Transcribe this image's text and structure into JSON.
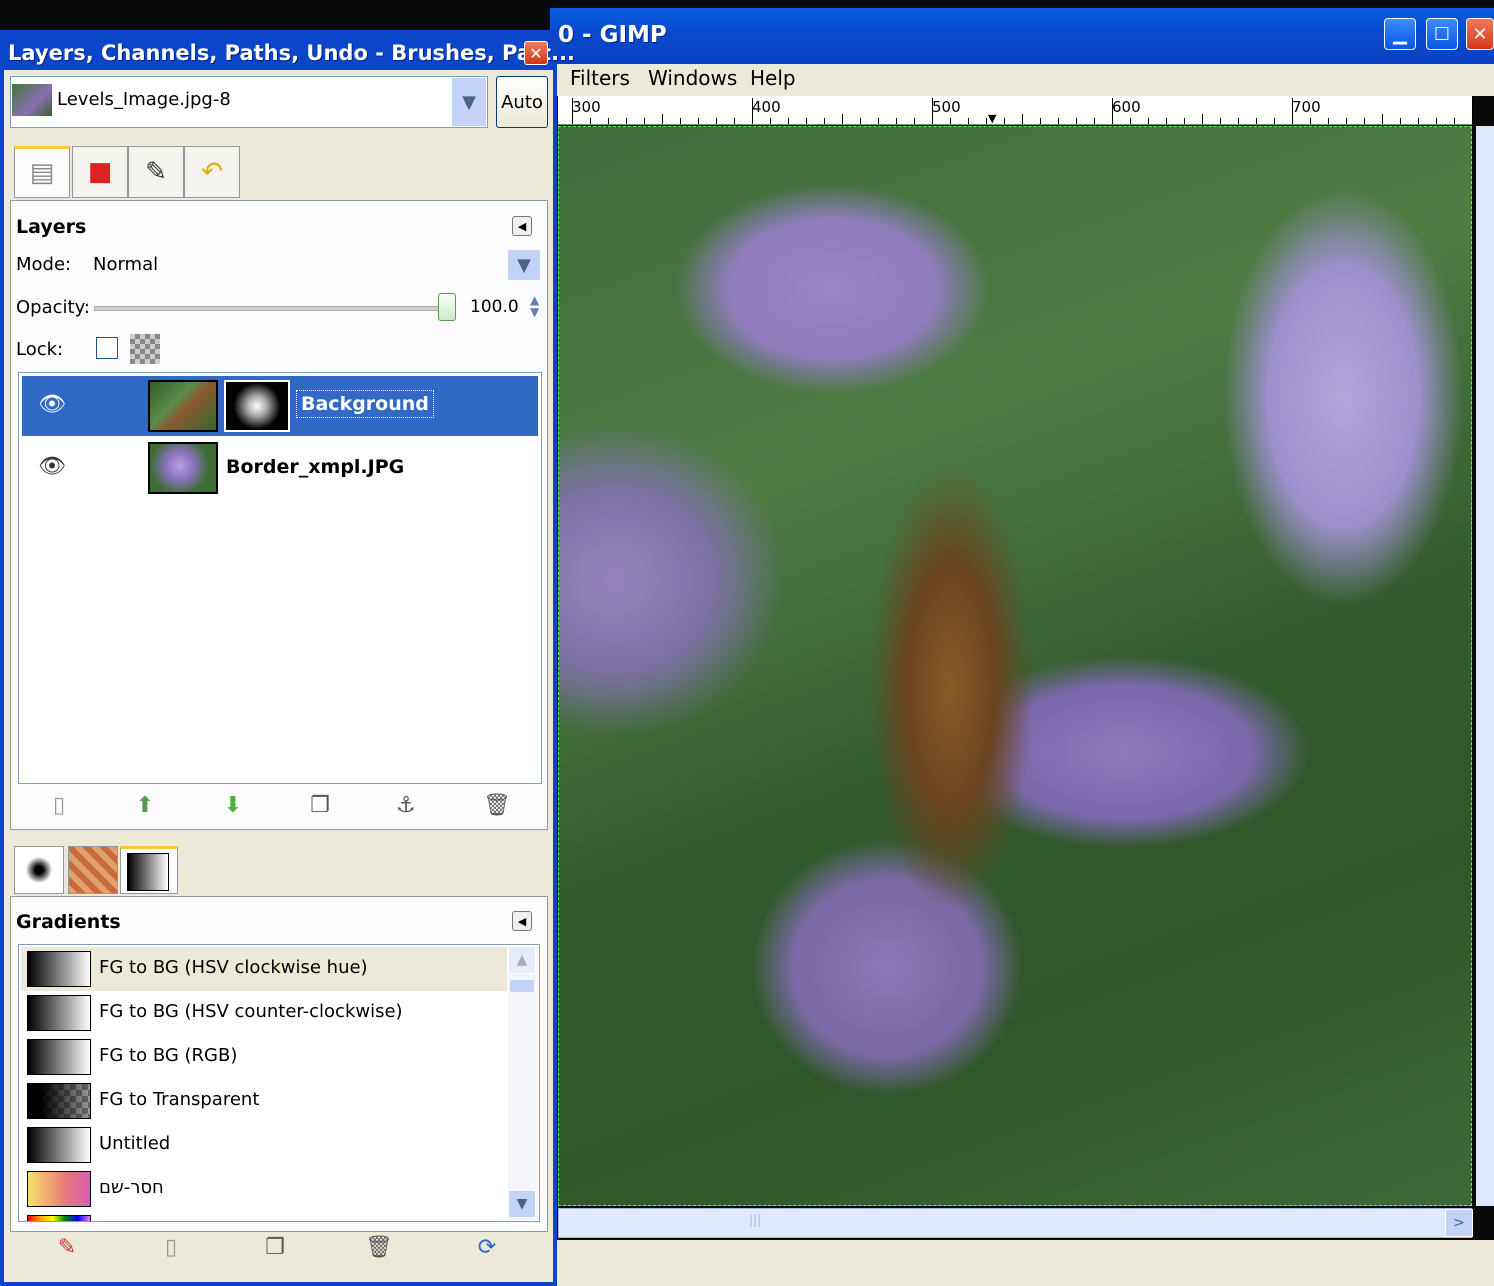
{
  "main_window": {
    "title": "0 - GIMP",
    "menu": [
      "Filters",
      "Windows",
      "Help"
    ],
    "ruler_labels": [
      "300",
      "400",
      "500",
      "600",
      "700"
    ]
  },
  "dock": {
    "title": "Layers, Channels, Paths, Undo - Brushes, Patt...",
    "image_combo": "Levels_Image.jpg-8",
    "auto_label": "Auto",
    "tabs": [
      "layers-icon",
      "channels-icon",
      "paths-icon",
      "undo-icon"
    ],
    "layers": {
      "title": "Layers",
      "mode_label": "Mode:",
      "mode_value": "Normal",
      "opacity_label": "Opacity:",
      "opacity_value": "100.0",
      "opacity_fraction": 1.0,
      "lock_label": "Lock:",
      "items": [
        {
          "name": "Background",
          "visible": true,
          "selected": true,
          "has_mask": true
        },
        {
          "name": "Border_xmpl.JPG",
          "visible": true,
          "selected": false,
          "has_mask": false
        }
      ],
      "toolbar": [
        "new-layer-icon",
        "raise-layer-icon",
        "lower-layer-icon",
        "duplicate-layer-icon",
        "anchor-icon",
        "delete-icon"
      ]
    },
    "gradients": {
      "title": "Gradients",
      "tabs": [
        "brush-icon",
        "pattern-icon",
        "gradient-icon"
      ],
      "items": [
        {
          "name": "FG to BG (HSV clockwise hue)"
        },
        {
          "name": "FG to BG (HSV counter-clockwise)"
        },
        {
          "name": "FG to BG (RGB)"
        },
        {
          "name": "FG to Transparent"
        },
        {
          "name": "Untitled"
        },
        {
          "name": "חסר-שם"
        }
      ],
      "toolbar": [
        "edit-gradient-icon",
        "new-gradient-icon",
        "duplicate-gradient-icon",
        "delete-gradient-icon",
        "refresh-icon"
      ]
    }
  },
  "colors": {
    "titlebar": "#0a4bd1",
    "selection": "#316ac5",
    "panel_bg": "#ece9d8"
  }
}
